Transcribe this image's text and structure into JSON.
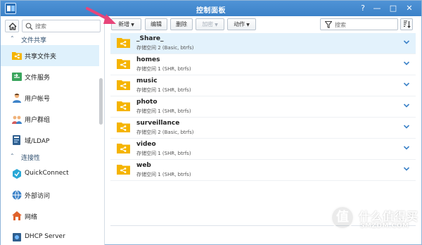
{
  "window": {
    "title": "控制面板"
  },
  "titlebar_buttons": [
    {
      "icon": "help-icon",
      "glyph": "?"
    },
    {
      "icon": "minimize-icon",
      "glyph": "—"
    },
    {
      "icon": "maximize-icon",
      "glyph": "□"
    },
    {
      "icon": "close-icon",
      "glyph": "✕"
    }
  ],
  "sidebar": {
    "search_placeholder": "搜索",
    "sections": [
      {
        "label": "文件共享"
      },
      {
        "label": "连接性"
      }
    ],
    "items": [
      {
        "label": "共享文件夹",
        "icon": "shared-folder-icon",
        "active": true
      },
      {
        "label": "文件服务",
        "icon": "file-services-icon"
      },
      {
        "label": "用户帐号",
        "icon": "user-icon"
      },
      {
        "label": "用户群组",
        "icon": "group-icon"
      },
      {
        "label": "域/LDAP",
        "icon": "domain-ldap-icon"
      },
      {
        "label": "QuickConnect",
        "icon": "quickconnect-icon"
      },
      {
        "label": "外部访问",
        "icon": "external-access-icon"
      },
      {
        "label": "网络",
        "icon": "network-icon"
      },
      {
        "label": "DHCP Server",
        "icon": "dhcp-server-icon"
      }
    ]
  },
  "toolbar": {
    "create_label": "新增",
    "edit_label": "编辑",
    "delete_label": "删除",
    "encrypt_label": "加密",
    "action_label": "动作",
    "search_placeholder": "搜索"
  },
  "folders": [
    {
      "name": "_Share_",
      "volume": "存储空间 2 (Basic, btrfs)",
      "selected": true
    },
    {
      "name": "homes",
      "volume": "存储空间 1 (SHR, btrfs)"
    },
    {
      "name": "music",
      "volume": "存储空间 1 (SHR, btrfs)"
    },
    {
      "name": "photo",
      "volume": "存储空间 1 (SHR, btrfs)"
    },
    {
      "name": "surveillance",
      "volume": "存储空间 2 (Basic, btrfs)"
    },
    {
      "name": "video",
      "volume": "存储空间 1 (SHR, btrfs)"
    },
    {
      "name": "web",
      "volume": "存储空间 1 (SHR, btrfs)"
    }
  ],
  "watermark": {
    "text": "什么值得买",
    "sub": "SMZDM.COM",
    "logo": "值"
  },
  "colors": {
    "accent": "#3c82c8",
    "folder": "#f5b400",
    "selected_row": "#e3f2fc",
    "arrow": "#e8457a"
  }
}
